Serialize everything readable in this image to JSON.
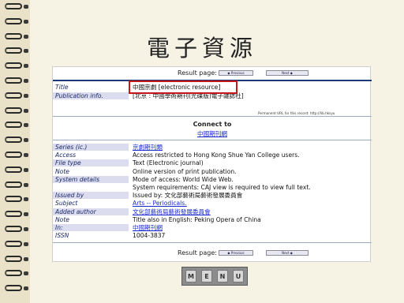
{
  "slide": {
    "title": "電子資源"
  },
  "result_bar": {
    "label": "Result page:",
    "prev_label": "◆ Previous",
    "next_label": "Next ◆"
  },
  "record_top": [
    {
      "label": "Title",
      "value": "中國京劇 [electronic resource]",
      "shaded": false,
      "link": false
    },
    {
      "label": "Publication info.",
      "value": "[北京 : 中國學術期刊(光碟版)電子雜誌社]",
      "shaded": true,
      "link": false
    }
  ],
  "permalink": "Permanent URL for this record: http://lib.hksyu",
  "connect": {
    "heading": "Connect to",
    "link": "中國期刊網"
  },
  "record_bottom": [
    {
      "label": "Series (ic.)",
      "value": "京劇期刊類",
      "shaded": true,
      "link": true
    },
    {
      "label": "Access",
      "value": "Access restricted to Hong Kong Shue Yan College users.",
      "shaded": false,
      "link": false
    },
    {
      "label": "File type",
      "value": "Text (Electronic journal)",
      "shaded": true,
      "link": false
    },
    {
      "label": "Note",
      "value": "Online version of print publication.",
      "shaded": false,
      "link": false
    },
    {
      "label": "System details",
      "value": "Mode of access: World Wide Web.",
      "shaded": true,
      "link": false
    },
    {
      "label": "",
      "value": "System requirements: CAJ view is required to view full text.",
      "shaded": false,
      "link": false
    },
    {
      "label": "Issued by",
      "value": "Issued by: 文化部藝術局藝術發展委員會",
      "shaded": true,
      "link": false
    },
    {
      "label": "Subject",
      "value": "Arts -- Periodicals.",
      "shaded": false,
      "link": true
    },
    {
      "label": "Added author",
      "value": "文化部藝術局藝術發展委員會",
      "shaded": true,
      "link": true
    },
    {
      "label": "Note",
      "value": "Title also in English: Peking Opera of China",
      "shaded": false,
      "link": false
    },
    {
      "label": "In:",
      "value": "中國期刊網",
      "shaded": true,
      "link": true
    },
    {
      "label": "ISSN",
      "value": "1004-3837",
      "shaded": false,
      "link": false
    }
  ],
  "menu": {
    "keys": [
      "M",
      "E",
      "N",
      "U"
    ]
  },
  "colors": {
    "label_shade": "#dcdcef",
    "link": "#1a2ad0",
    "highlight": "#c41818",
    "header_rule": "#1c3a7a"
  }
}
